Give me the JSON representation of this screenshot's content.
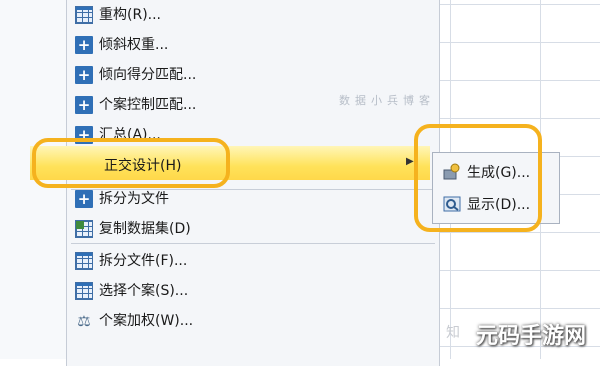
{
  "menu": {
    "items": [
      {
        "label": "重构(R)...",
        "icon": "table-icon"
      },
      {
        "label": "倾斜权重...",
        "icon": "plus-icon"
      },
      {
        "label": "倾向得分匹配...",
        "icon": "plus-icon"
      },
      {
        "label": "个案控制匹配...",
        "icon": "plus-icon"
      },
      {
        "label": "汇总(A)...",
        "icon": "plus-icon"
      },
      {
        "label": "正交设计(H)",
        "icon": ""
      },
      {
        "label": "拆分为文件",
        "icon": "plus-icon"
      },
      {
        "label": "复制数据集(D)",
        "icon": "dataset-icon"
      },
      {
        "label": "拆分文件(F)...",
        "icon": "table-icon"
      },
      {
        "label": "选择个案(S)...",
        "icon": "table-icon"
      },
      {
        "label": "个案加权(W)...",
        "icon": "weight-icon"
      }
    ]
  },
  "submenu": {
    "items": [
      {
        "label": "生成(G)...",
        "icon": "generate-icon"
      },
      {
        "label": "显示(D)...",
        "icon": "display-icon"
      }
    ]
  },
  "watermark": "数据小兵博客",
  "brand": "元码手游网",
  "zhihu_mark": "知",
  "colors": {
    "highlight": "#ffe25a",
    "annotation": "#f5b21e",
    "icon_blue": "#2f6fb6"
  }
}
